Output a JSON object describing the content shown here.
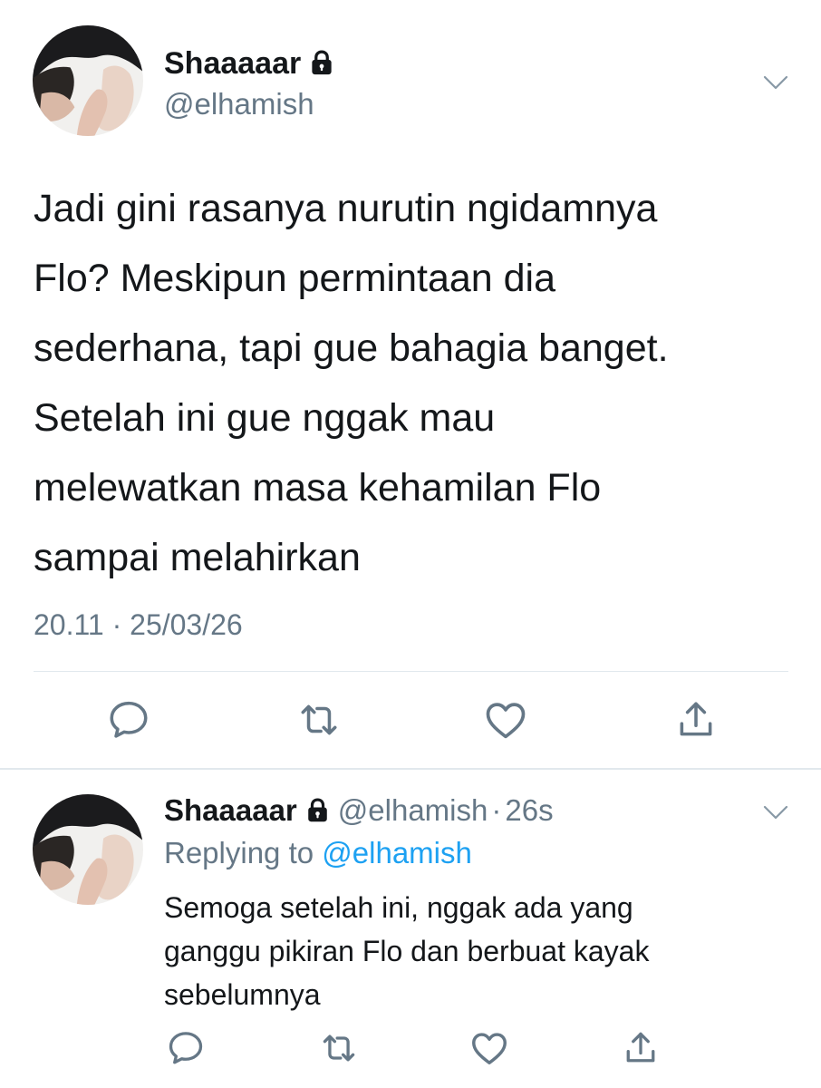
{
  "main_tweet": {
    "display_name": "Shaaaaar",
    "handle": "@elhamish",
    "text": "Jadi gini rasanya nurutin ngidamnya\nFlo? Meskipun permintaan dia\nsederhana, tapi gue bahagia banget.\nSetelah ini gue nggak mau\nmelewatkan masa kehamilan Flo\nsampai melahirkan",
    "timestamp": "20.11 · 25/03/26",
    "icons": {
      "lock": "lock-icon",
      "menu": "chevron-down-icon",
      "reply": "reply-icon",
      "retweet": "retweet-icon",
      "like": "heart-icon",
      "share": "share-icon"
    }
  },
  "reply_tweet": {
    "display_name": "Shaaaaar",
    "handle": "@elhamish",
    "separator": "·",
    "time": "26s",
    "replying_prefix": "Replying to",
    "replying_handle": "@elhamish",
    "text": "Semoga setelah ini, nggak ada yang\nganggu pikiran Flo dan berbuat kayak\nsebelumnya"
  },
  "colors": {
    "text": "#14171a",
    "secondary": "#657786",
    "link": "#1da1f2",
    "divider": "#e1e8ed"
  }
}
